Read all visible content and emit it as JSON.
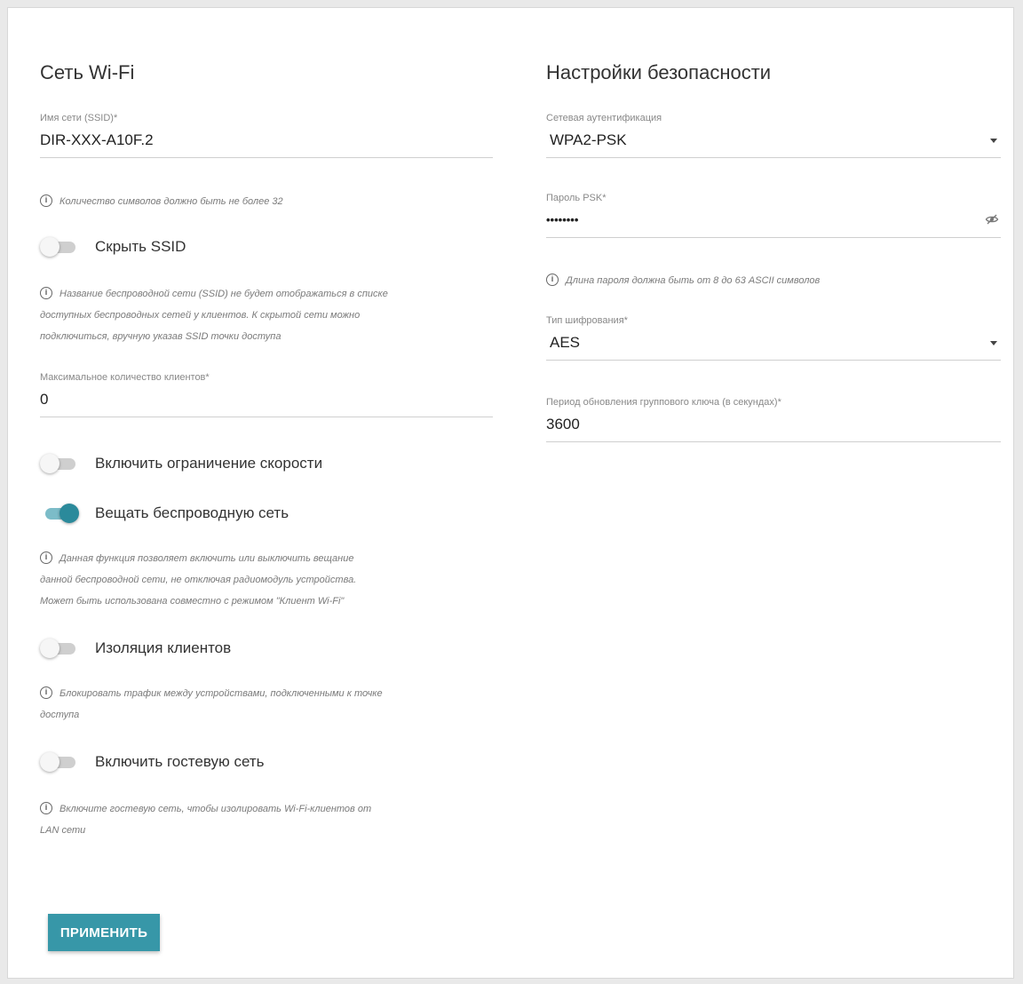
{
  "wifi": {
    "title": "Сеть Wi-Fi",
    "ssid_label": "Имя сети (SSID)*",
    "ssid_value": "DIR-XXX-A10F.2",
    "ssid_hint": "Количество символов должно быть не более 32",
    "hide_ssid": {
      "label": "Скрыть SSID",
      "on": false
    },
    "hide_ssid_hint_lines": [
      "Название беспроводной сети (SSID) не будет отображаться в списке",
      "доступных беспроводных сетей у клиентов. К скрытой сети можно",
      "подключиться, вручную указав SSID точки доступа"
    ],
    "max_clients_label": "Максимальное количество клиентов*",
    "max_clients_value": "0",
    "speed_limit": {
      "label": "Включить ограничение скорости",
      "on": false
    },
    "broadcast": {
      "label": "Вещать беспроводную сеть",
      "on": true
    },
    "broadcast_hint_lines": [
      "Данная функция позволяет включить или выключить вещание",
      "данной беспроводной сети, не отключая радиомодуль устройства.",
      "Может быть использована совместно с режимом \"Клиент Wi-Fi\""
    ],
    "isolation": {
      "label": "Изоляция клиентов",
      "on": false
    },
    "isolation_hint_lines": [
      "Блокировать трафик между устройствами, подключенными к точке",
      "доступа"
    ],
    "guest": {
      "label": "Включить гостевую сеть",
      "on": false
    },
    "guest_hint_lines": [
      "Включите гостевую сеть, чтобы изолировать Wi-Fi-клиентов от",
      "LAN сети"
    ]
  },
  "security": {
    "title": "Настройки безопасности",
    "auth_label": "Сетевая аутентификация",
    "auth_value": "WPA2-PSK",
    "psk_label": "Пароль PSK*",
    "psk_value": "••••••••",
    "psk_hint": "Длина пароля должна быть от 8 до 63 ASCII символов",
    "encryption_label": "Тип шифрования*",
    "encryption_value": "AES",
    "rekey_label": "Период обновления группового ключа (в секундах)*",
    "rekey_value": "3600"
  },
  "apply_label": "ПРИМЕНИТЬ",
  "icons": {
    "info": "info-icon",
    "eye": "eye-off-icon",
    "dropdown": "caret-down-icon"
  },
  "colors": {
    "accent": "#2b8a9b",
    "button": "#3797a8"
  }
}
